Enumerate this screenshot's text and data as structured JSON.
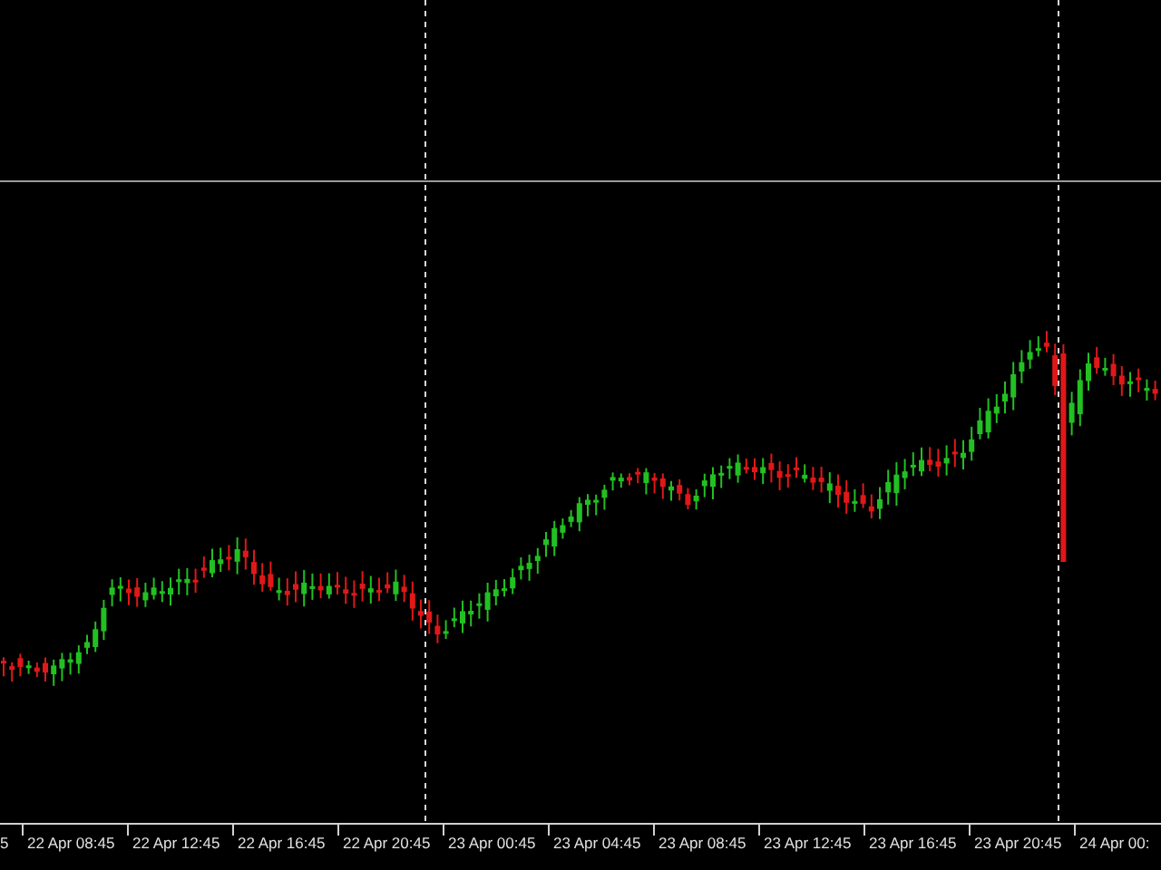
{
  "chart": {
    "kind": "candlestick"
  },
  "time_axis": {
    "labels": [
      "5",
      "22 Apr 08:45",
      "22 Apr 12:45",
      "22 Apr 16:45",
      "22 Apr 20:45",
      "23 Apr 00:45",
      "23 Apr 04:45",
      "23 Apr 08:45",
      "23 Apr 12:45",
      "23 Apr 16:45",
      "23 Apr 20:45",
      "24 Apr 00:"
    ]
  }
}
